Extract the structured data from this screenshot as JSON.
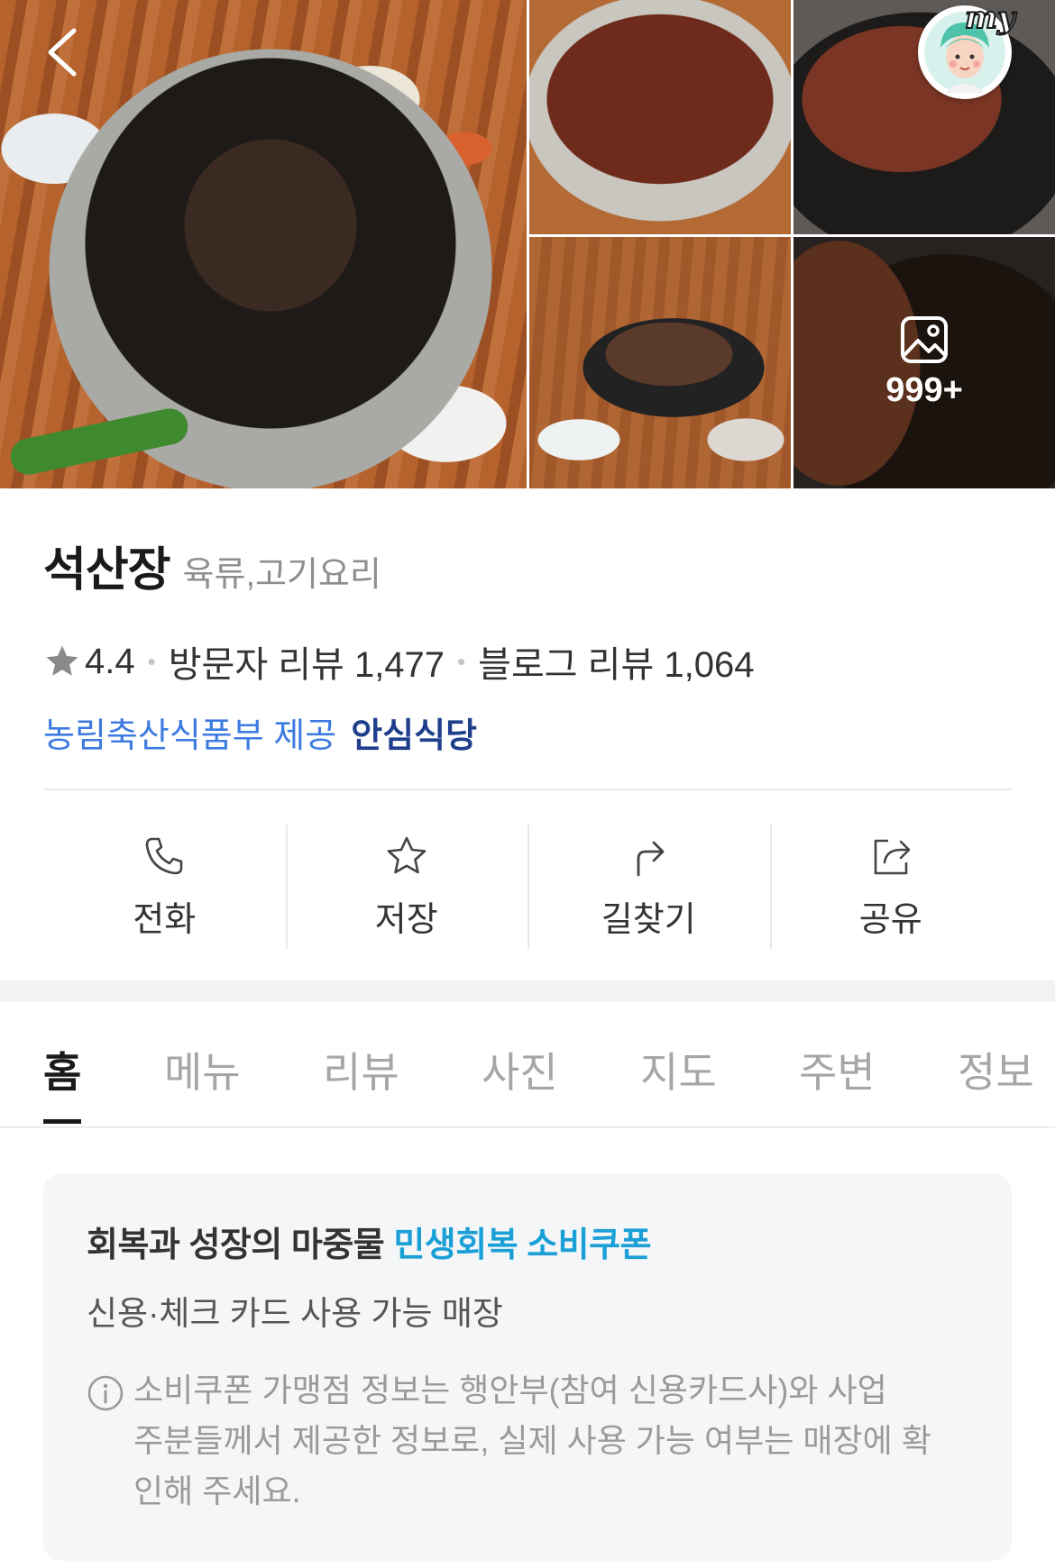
{
  "header": {
    "photo_count": "999+",
    "avatar_badge": "my"
  },
  "place": {
    "name": "석산장",
    "category": "육류,고기요리",
    "rating": "4.4",
    "visitor_reviews": "방문자 리뷰 1,477",
    "blog_reviews": "블로그 리뷰 1,064",
    "provider": "농림축산식품부 제공",
    "safe_badge": "안심식당"
  },
  "actions": [
    {
      "label": "전화",
      "icon": "phone-icon"
    },
    {
      "label": "저장",
      "icon": "star-icon"
    },
    {
      "label": "길찾기",
      "icon": "directions-icon"
    },
    {
      "label": "공유",
      "icon": "share-icon"
    }
  ],
  "tabs": [
    {
      "label": "홈",
      "active": true
    },
    {
      "label": "메뉴",
      "active": false
    },
    {
      "label": "리뷰",
      "active": false
    },
    {
      "label": "사진",
      "active": false
    },
    {
      "label": "지도",
      "active": false
    },
    {
      "label": "주변",
      "active": false
    },
    {
      "label": "정보",
      "active": false
    }
  ],
  "coupon": {
    "title_prefix": "회복과 성장의 마중물",
    "title_highlight": "민생회복 소비쿠폰",
    "subtitle": "신용·체크 카드 사용 가능 매장",
    "note_lines": [
      "소비쿠폰 가맹점 정보는 행안부(참여 신용카드사)와 사업",
      "주분들께서 제공한 정보로, 실제 사용 가능 여부는 매장에 확",
      "인해 주세요."
    ]
  },
  "colors": {
    "accent_blue": "#3d7be0",
    "safe_navy": "#1f3f8c",
    "coupon_highlight": "#1a9fd6"
  }
}
